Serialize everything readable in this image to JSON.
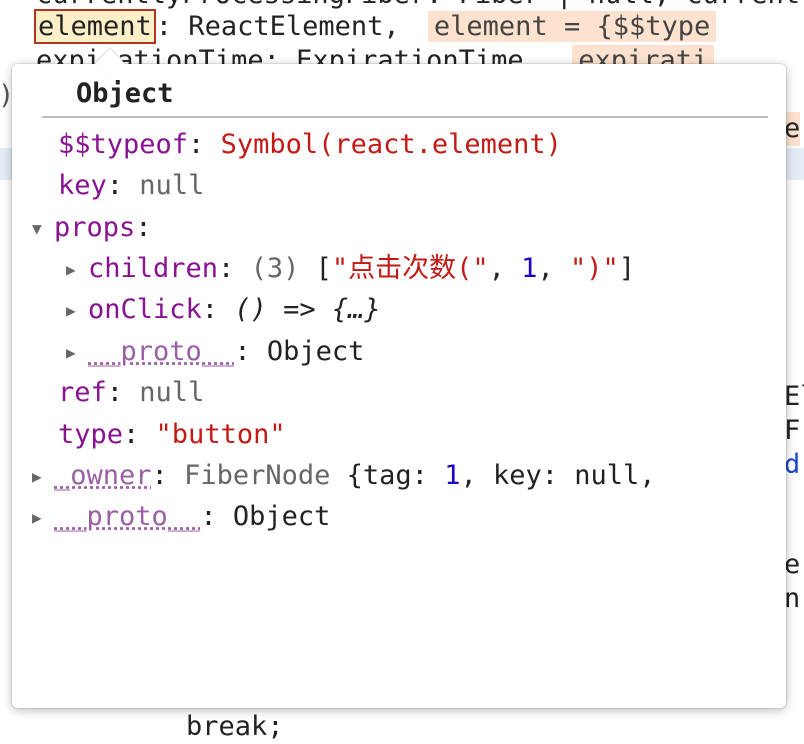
{
  "editor": {
    "top_line_clip": "currentlyProcessingFiber: Fiber | null, currentl",
    "line1_name": "element",
    "line1_rest": ": ReactElement,",
    "line1_hint": "element = {$$type",
    "line2_text": "expirationTime: ExpirationTime,",
    "line2_hint": "expirati",
    "peek_mark": ")",
    "right_e": "e",
    "right_el": "El",
    "right_f": "F",
    "right_d": "d",
    "right_e2": "e",
    "right_n": "n",
    "bottom_text": "break;"
  },
  "popover": {
    "title": "Object",
    "rows": {
      "typeof_key": "$$typeof",
      "typeof_val": "Symbol(react.element)",
      "key_key": "key",
      "key_val": "null",
      "props_key": "props",
      "children_key": "children",
      "children_count": "(3)",
      "children_open": "[",
      "children_s1": "\"点击次数(\"",
      "children_n": "1",
      "children_s2": "\")\"",
      "children_close": "]",
      "onclick_key": "onClick",
      "onclick_val": "() => {…}",
      "props_proto_key": "__proto__",
      "props_proto_val": "Object",
      "ref_key": "ref",
      "ref_val": "null",
      "type_key": "type",
      "type_val": "\"button\"",
      "owner_key": "_owner",
      "owner_class": "FiberNode",
      "owner_open": "{tag:",
      "owner_tag": "1",
      "owner_rest": ", key: null,",
      "proto_key": "__proto__",
      "proto_val": "Object"
    },
    "icons": {
      "collapsed": "triangle-right-icon",
      "expanded": "triangle-down-icon"
    }
  }
}
